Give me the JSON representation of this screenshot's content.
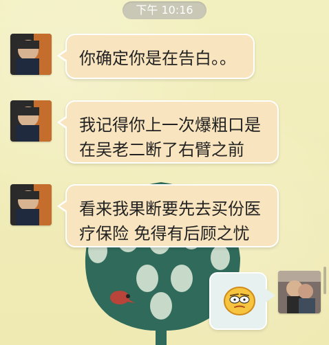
{
  "status": {
    "time": "下午 10:16"
  },
  "messages": [
    {
      "side": "left",
      "text": "你确定你是在告白。。"
    },
    {
      "side": "left",
      "text": "我记得你上一次爆粗口是在吴老二断了右臂之前"
    },
    {
      "side": "left",
      "text": "看来我果断要先去买份医疗保险 免得有后顾之忧"
    },
    {
      "side": "right",
      "icon": "emoji-face"
    }
  ],
  "theme": {
    "background": "#f2efb8",
    "left_bubble": "#f8e4be",
    "right_bubble": "#e7f1ef",
    "time_pill": "#c9c7b5"
  }
}
